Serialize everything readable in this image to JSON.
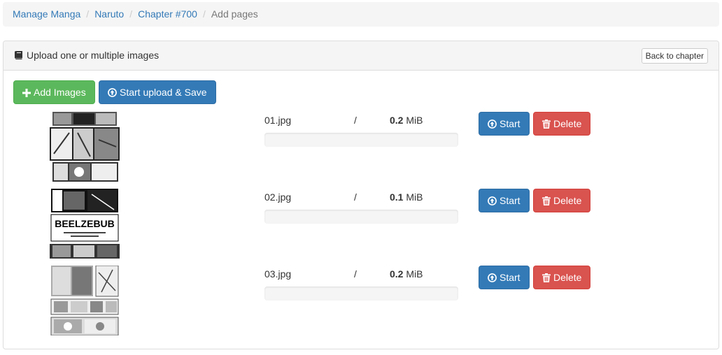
{
  "breadcrumb": {
    "items": [
      "Manage Manga",
      "Naruto",
      "Chapter #700"
    ],
    "active": "Add pages"
  },
  "panel": {
    "title": "Upload one or multiple images",
    "back_label": "Back to chapter"
  },
  "toolbar": {
    "add_label": "Add Images",
    "start_all_label": "Start upload & Save"
  },
  "files": [
    {
      "name": "01.jpg",
      "slash": "/",
      "size_value": "0.2",
      "size_unit": "MiB",
      "progress": 0,
      "start_label": "Start",
      "delete_label": "Delete"
    },
    {
      "name": "02.jpg",
      "slash": "/",
      "size_value": "0.1",
      "size_unit": "MiB",
      "progress": 0,
      "start_label": "Start",
      "delete_label": "Delete",
      "thumb_text": "BEELZEBUB"
    },
    {
      "name": "03.jpg",
      "slash": "/",
      "size_value": "0.2",
      "size_unit": "MiB",
      "progress": 0,
      "start_label": "Start",
      "delete_label": "Delete"
    }
  ],
  "colors": {
    "success": "#5cb85c",
    "primary": "#337ab7",
    "danger": "#d9534f",
    "link": "#337ab7"
  },
  "icons": {
    "heading": "book-icon",
    "add": "plus-icon",
    "upload": "upload-circle-icon",
    "delete": "trash-icon"
  }
}
